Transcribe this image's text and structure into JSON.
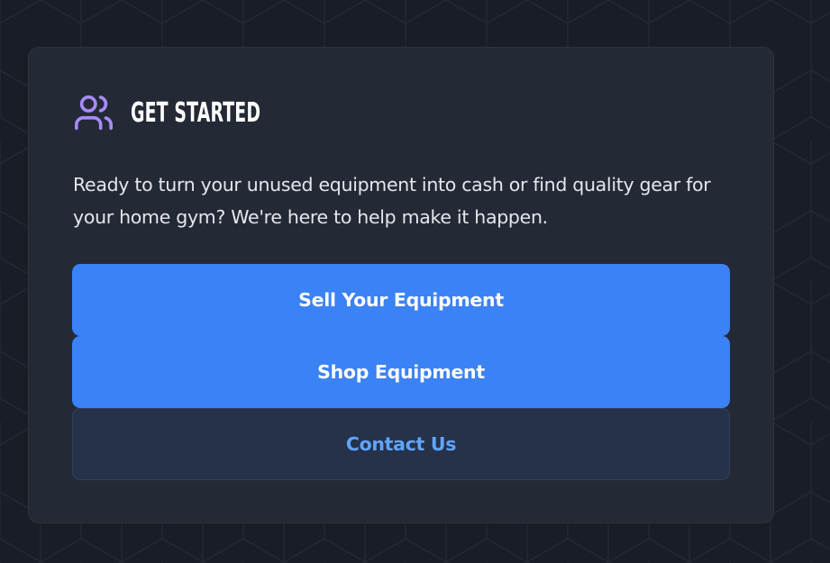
{
  "section": {
    "title": "GET STARTED",
    "icon": "users-icon",
    "description": "Ready to turn your unused equipment into cash or find quality gear for your home gym? We're here to help make it happen."
  },
  "actions": {
    "sell_label": "Sell Your Equipment",
    "shop_label": "Shop Equipment",
    "contact_label": "Contact Us"
  },
  "colors": {
    "background": "#191d25",
    "card": "#242936",
    "icon_accent": "#a78bfa",
    "primary_button": "#3b82f6",
    "secondary_button": "#26314a",
    "secondary_text": "#60a5fa"
  }
}
